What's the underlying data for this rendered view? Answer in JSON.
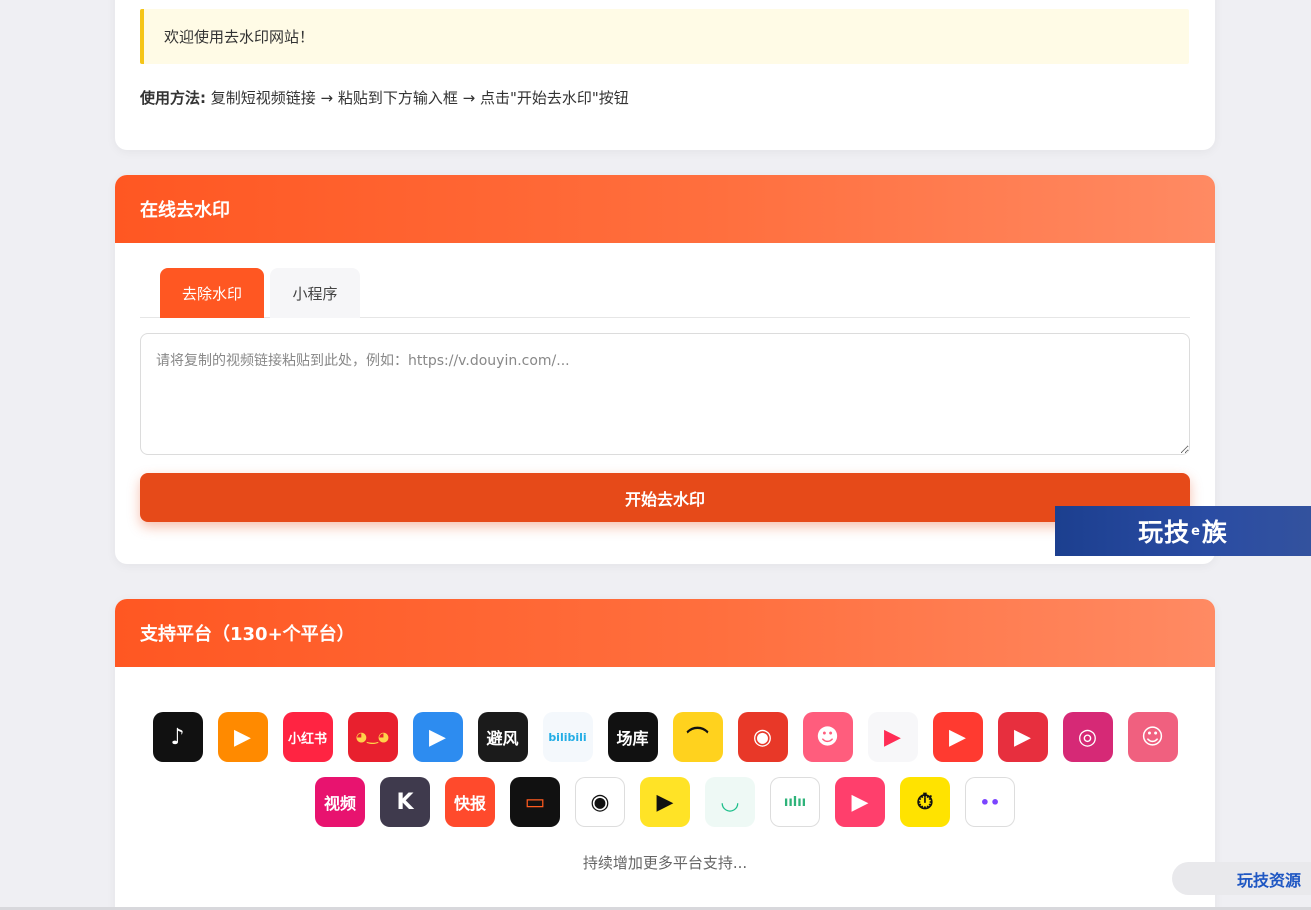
{
  "notice": {
    "text": "欢迎使用去水印网站！"
  },
  "usage": {
    "label": "使用方法:",
    "text": "复制短视频链接 → 粘贴到下方输入框 → 点击\"开始去水印\"按钮"
  },
  "online": {
    "title": "在线去水印",
    "tabs": [
      {
        "label": "去除水印"
      },
      {
        "label": "小程序"
      }
    ],
    "input_placeholder": "请将复制的视频链接粘贴到此处，例如：https://v.douyin.com/...",
    "submit_label": "开始去水印"
  },
  "platforms": {
    "title": "支持平台（130+个平台）",
    "row1": [
      {
        "icon": "douyin-icon",
        "glyph": "♪",
        "bg": "#111111",
        "fg": "#ffffff"
      },
      {
        "icon": "kuaishou-icon",
        "glyph": "▶",
        "bg": "#ff8a00",
        "fg": "#ffffff"
      },
      {
        "icon": "xiaohongshu-icon",
        "glyph": "小红书",
        "bg": "#ff2442",
        "fg": "#ffffff"
      },
      {
        "icon": "cartoon-girl-icon",
        "glyph": "◕‿◕",
        "bg": "#e8202e",
        "fg": "#ffd24a"
      },
      {
        "icon": "blue-play-icon",
        "glyph": "▶",
        "bg": "#2d8cf0",
        "fg": "#ffffff"
      },
      {
        "icon": "bifeng-icon",
        "glyph": "避风",
        "bg": "#1b1b1b",
        "fg": "#ffffff"
      },
      {
        "icon": "bilibili-icon",
        "glyph": "bilibili",
        "bg": "#f4f8fc",
        "fg": "#23ade5"
      },
      {
        "icon": "changku-icon",
        "glyph": "场库",
        "bg": "#111111",
        "fg": "#ffffff"
      },
      {
        "icon": "yellow-arch-icon",
        "glyph": "⌒",
        "bg": "#ffd21e",
        "fg": "#111111"
      },
      {
        "icon": "monkey-icon",
        "glyph": "◉",
        "bg": "#e83828",
        "fg": "#ffffff"
      },
      {
        "icon": "face-cartoon-icon",
        "glyph": "☻",
        "bg": "#ff5d7d",
        "fg": "#ffffff"
      },
      {
        "icon": "play-triangle-icon",
        "glyph": "▶",
        "bg": "#f7f7f9",
        "fg": "#ff2d55"
      },
      {
        "icon": "flame-play-icon",
        "glyph": "▶",
        "bg": "#ff3a30",
        "fg": "#ffffff"
      },
      {
        "icon": "red-grid-play-icon",
        "glyph": "▶",
        "bg": "#e72f3e",
        "fg": "#ffffff"
      },
      {
        "icon": "instagram-icon",
        "glyph": "◎",
        "bg": "#d62976",
        "fg": "#ffffff"
      },
      {
        "icon": "laughing-face-icon",
        "glyph": "☺",
        "bg": "#f0607f",
        "fg": "#ffffff"
      }
    ],
    "row2": [
      {
        "icon": "tencent-video-icon",
        "glyph": "视频",
        "bg": "#e8136f",
        "fg": "#ffffff"
      },
      {
        "icon": "k-letter-icon",
        "glyph": "K",
        "bg": "#3f3a4d",
        "fg": "#ffffff"
      },
      {
        "icon": "kuaibao-icon",
        "glyph": "快报",
        "bg": "#ff4a2c",
        "fg": "#ffffff"
      },
      {
        "icon": "orange-frame-icon",
        "glyph": "▭",
        "bg": "#111111",
        "fg": "#ff5b1f"
      },
      {
        "icon": "eye-icon",
        "glyph": "◉",
        "bg": "#ffffff",
        "fg": "#111111"
      },
      {
        "icon": "pear-play-icon",
        "glyph": "▶",
        "bg": "#ffe326",
        "fg": "#111111"
      },
      {
        "icon": "bowl-icon",
        "glyph": "◡",
        "bg": "#eef9f5",
        "fg": "#1cbf8a"
      },
      {
        "icon": "bamboo-icon",
        "glyph": "ıılıı",
        "bg": "#ffffff",
        "fg": "#2eb37a"
      },
      {
        "icon": "camera-icon",
        "glyph": "▶",
        "bg": "#ff3f6c",
        "fg": "#ffffff"
      },
      {
        "icon": "stopwatch-play-icon",
        "glyph": "⏱",
        "bg": "#ffe300",
        "fg": "#111111"
      },
      {
        "icon": "chat-bubble-icon",
        "glyph": "••",
        "bg": "#ffffff",
        "fg": "#7b45ff"
      }
    ],
    "more_text": "持续增加更多平台支持..."
  },
  "watermarks": {
    "banner_left": "玩技",
    "banner_mid": "e",
    "banner_right": "族",
    "corner": "玩技资源"
  }
}
